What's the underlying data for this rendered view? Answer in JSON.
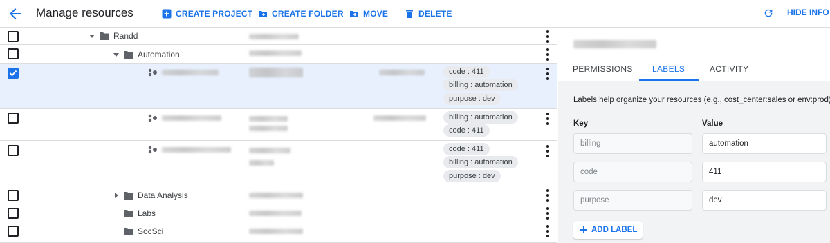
{
  "header": {
    "title": "Manage resources",
    "buttons": {
      "create_project": "CREATE PROJECT",
      "create_folder": "CREATE FOLDER",
      "move": "MOVE",
      "delete": "DELETE"
    },
    "hide_info": "HIDE INFO P"
  },
  "resources": [
    {
      "kind": "folder",
      "name": "Randd",
      "expanded": true,
      "checked": false
    },
    {
      "kind": "folder",
      "name": "Automation",
      "expanded": true,
      "checked": false
    },
    {
      "kind": "project",
      "name": "",
      "checked": true,
      "labels": [
        "code : 411",
        "billing : automation",
        "purpose : dev"
      ]
    },
    {
      "kind": "project",
      "name": "",
      "checked": false,
      "labels": [
        "billing : automation",
        "code : 411"
      ]
    },
    {
      "kind": "project",
      "name": "",
      "checked": false,
      "labels": [
        "code : 411",
        "billing : automation",
        "purpose : dev"
      ]
    },
    {
      "kind": "folder",
      "name": "Data Analysis",
      "expanded": false,
      "checked": false
    },
    {
      "kind": "folder",
      "name": "Labs",
      "checked": false
    },
    {
      "kind": "folder",
      "name": "SocSci",
      "checked": false
    }
  ],
  "info_panel": {
    "tabs": [
      "PERMISSIONS",
      "LABELS",
      "ACTIVITY"
    ],
    "active_tab": "LABELS",
    "help_text": "Labels help organize your resources (e.g., cost_center:sales or env:prod).",
    "key_header": "Key",
    "value_header": "Value",
    "labels": [
      {
        "key": "billing",
        "value": "automation"
      },
      {
        "key": "code",
        "value": "411"
      },
      {
        "key": "purpose",
        "value": "dev"
      }
    ],
    "add_label": "ADD LABEL"
  },
  "colors": {
    "accent": "#1a73e8",
    "selected_row": "#e8f0fe",
    "chip": "#e8eaed"
  }
}
